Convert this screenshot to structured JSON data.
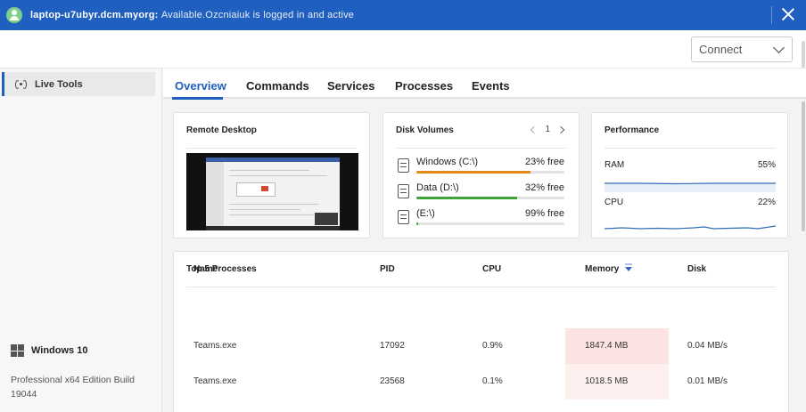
{
  "banner": {
    "host": "laptop-u7ubyr.dcm.myorg:",
    "status": "Available.Ozcniaiuk is logged in and active"
  },
  "connect": {
    "label": "Connect"
  },
  "sidebar": {
    "items": [
      {
        "label": "Live Tools",
        "icon": "live-tools-icon"
      }
    ],
    "os": {
      "name": "Windows 10",
      "detail": "Professional x64 Edition Build 19044"
    }
  },
  "tabs": [
    "Overview",
    "Commands",
    "Services",
    "Processes",
    "Events"
  ],
  "remote_desktop": {
    "title": "Remote Desktop"
  },
  "disk_volumes": {
    "title": "Disk Volumes",
    "page": "1",
    "volumes": [
      {
        "name": "Windows (C:\\)",
        "free": "23% free",
        "used_fraction": 0.77,
        "color": "#e3891a"
      },
      {
        "name": "Data (D:\\)",
        "free": "32% free",
        "used_fraction": 0.68,
        "color": "#3da33a"
      },
      {
        "name": "(E:\\)",
        "free": "99% free",
        "used_fraction": 0.01,
        "color": "#3da33a"
      }
    ]
  },
  "performance": {
    "title": "Performance",
    "metrics": [
      {
        "label": "RAM",
        "value": "55%"
      },
      {
        "label": "CPU",
        "value": "22%"
      }
    ],
    "line_color": "#2f6db5"
  },
  "top_processes": {
    "title": "Top 5 Processes",
    "columns": [
      "Name",
      "PID",
      "CPU",
      "Memory",
      "Disk"
    ],
    "sorted_by": "Memory",
    "rows": [
      {
        "name": "Teams.exe",
        "pid": "17092",
        "cpu": "0.9%",
        "memory": "1847.4 MB",
        "disk": "0.04 MB/s"
      },
      {
        "name": "Teams.exe",
        "pid": "23568",
        "cpu": "0.1%",
        "memory": "1018.5 MB",
        "disk": "0.01 MB/s"
      }
    ]
  }
}
